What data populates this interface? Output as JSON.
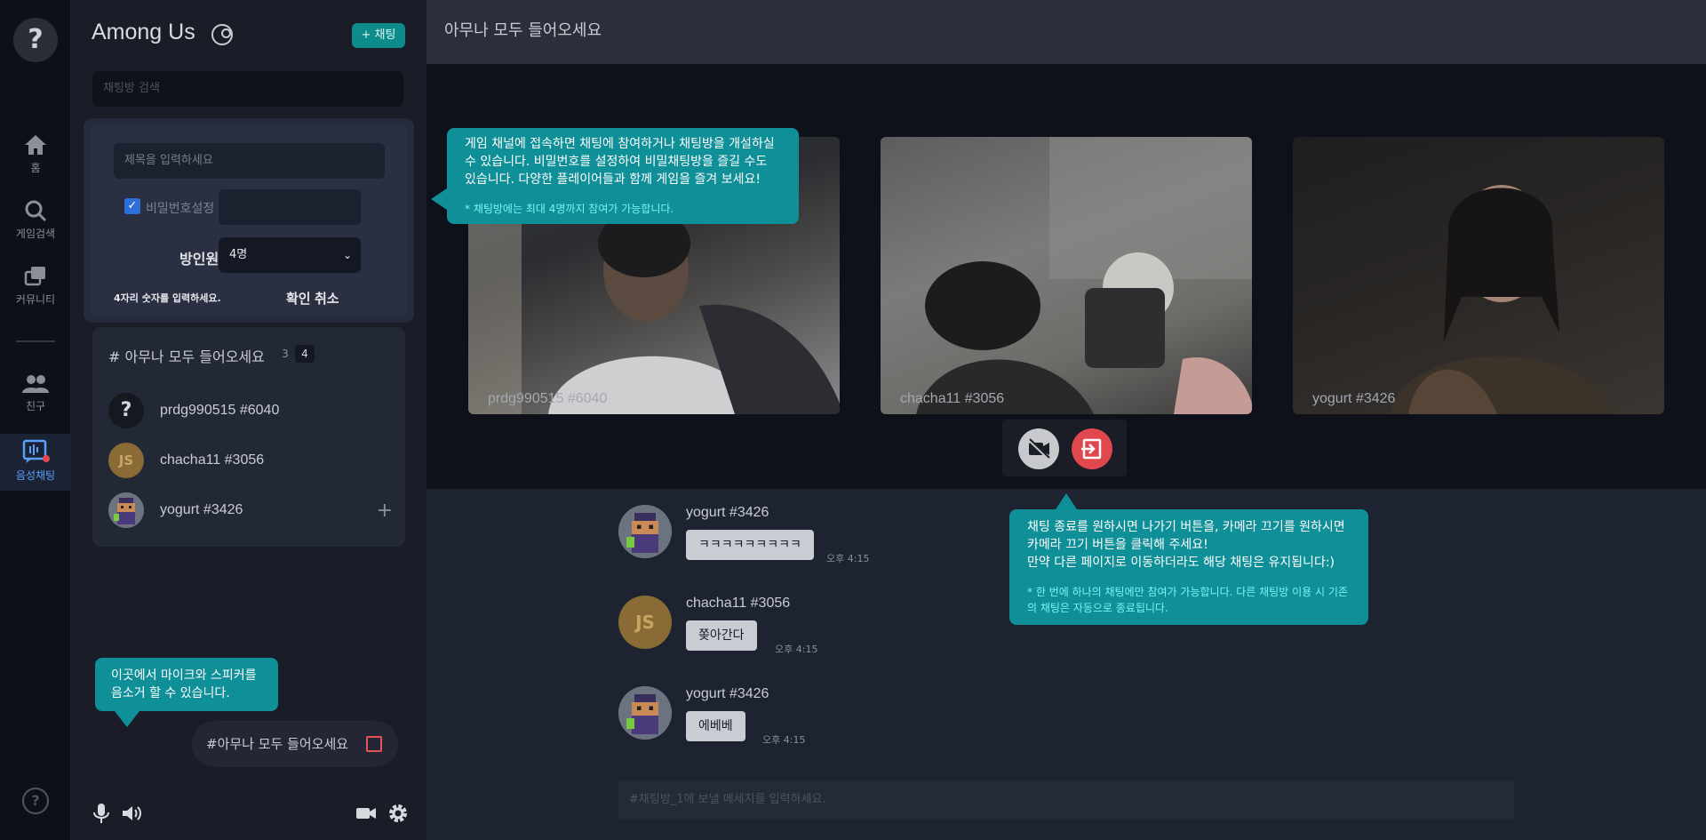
{
  "rail": {
    "logo": "?",
    "items": [
      {
        "label": "홈",
        "icon": "home-icon"
      },
      {
        "label": "게임검색",
        "icon": "search-icon"
      },
      {
        "label": "커뮤니티",
        "icon": "community-icon"
      },
      {
        "label": "친구",
        "icon": "friends-icon"
      },
      {
        "label": "음성채팅",
        "icon": "voice-chat-icon"
      }
    ],
    "help": "?"
  },
  "panel": {
    "title": "Among Us",
    "add_label": "+ 채팅",
    "search_placeholder": "채팅방 검색"
  },
  "form": {
    "title_placeholder": "제목을 입력하세요",
    "password_label": "비밀번호설정",
    "capacity_label": "방인원수",
    "capacity_value": "4명",
    "hint": "4자리 숫자를 입력하세요.",
    "ok_label": "확인",
    "cancel_label": "취소"
  },
  "room": {
    "name": "# 아무나 모두 들어오세요",
    "current": "3",
    "max": "4",
    "members": [
      {
        "name": "prdg990515 #6040",
        "avatar": "?"
      },
      {
        "name": "chacha11 #3056",
        "avatar": "JS"
      },
      {
        "name": "yogurt #3426",
        "avatar": ""
      }
    ]
  },
  "tips": {
    "channel": {
      "text": "게임 채널에 접속하면 채팅에 참여하거나 채팅방을 개설하실 수 있습니다. 비밀번호를 설정하여 비밀채팅방을 즐길 수도 있습니다. 다양한 플레이어들과 함께 게임을 즐겨 보세요!",
      "note": "* 채팅방에는 최대 4명까지 참여가 가능합니다."
    },
    "mute": {
      "text": "이곳에서 마이크와 스피커를 음소거 할 수 있습니다."
    },
    "leave": {
      "line1": "채팅 종료를 원하시면 나가기 버튼을, 카메라 끄기를 원하시면",
      "line2": "카메라 끄기 버튼을 클릭해 주세요!",
      "line3": "만약 다른 페이지로 이동하더라도 해당 채팅은 유지됩니다:)",
      "note": "* 한 번에 하나의 채팅에만 참여가 가능합니다. 다른 채팅방 이용 시 기존의 채팅은 자동으로 종료됩니다."
    }
  },
  "current_room_pill": "#아무나 모두 들어오세요",
  "main": {
    "header": "아무나 모두 들어오세요",
    "videos": [
      {
        "name": "prdg990515 #6040"
      },
      {
        "name": "chacha11 #3056"
      },
      {
        "name": "yogurt #3426"
      }
    ],
    "messages": [
      {
        "author": "yogurt #3426",
        "text": "ㅋㅋㅋㅋㅋㅋㅋㅋㅋ",
        "time": "오후 4:15",
        "avatar": ""
      },
      {
        "author": "chacha11 #3056",
        "text": "쫒아간다",
        "time": "오후 4:15",
        "avatar": "JS"
      },
      {
        "author": "yogurt #3426",
        "text": "에베베",
        "time": "오후 4:15",
        "avatar": ""
      }
    ],
    "input_placeholder": "#채팅방_1에 보낼 메세지를 입력하세요."
  },
  "colors": {
    "accent_teal": "#0f8f98",
    "leave_red": "#e0474f",
    "active_blue": "#5aa0ff"
  }
}
